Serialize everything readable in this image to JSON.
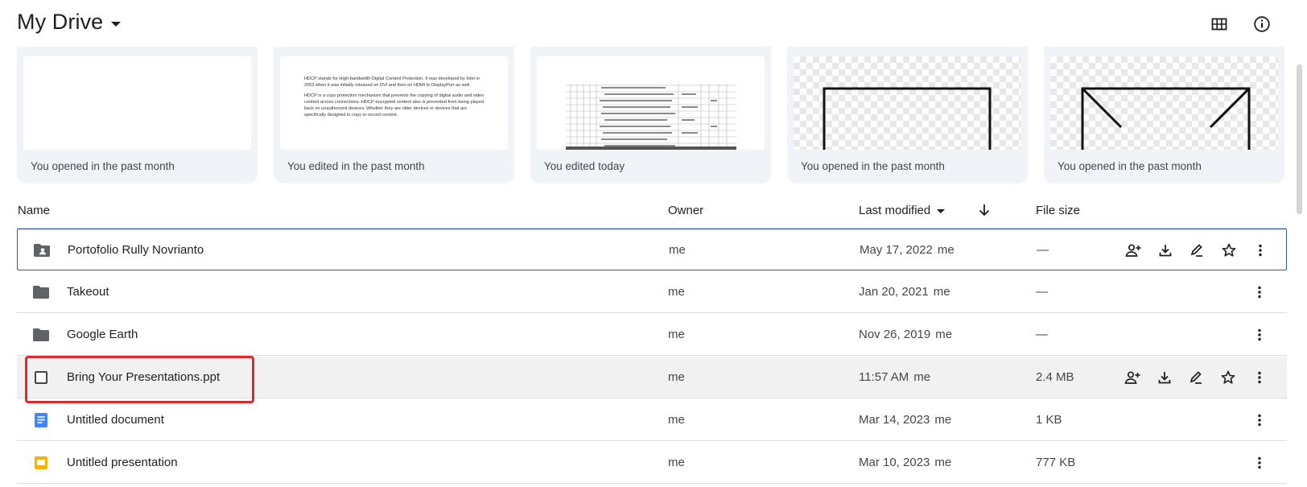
{
  "header": {
    "title": "My Drive",
    "icons": [
      "grid-view-icon",
      "info-icon"
    ]
  },
  "suggested": [
    {
      "caption": "You opened in the past month",
      "preview": "blank"
    },
    {
      "caption": "You edited in the past month",
      "preview": "document",
      "preview_text": [
        "HDCP stands for High-bandwidth Digital Content Protection. It was developed by Intel in 2003 when it was initially released on DVI and then on HDMI to DisplayPort as well.",
        "HDCP is a copy protection mechanism that prevents the copying of digital audio and video content across connections. HDCP-encrypted content also is prevented from being played back on unauthorized devices. Whether they are older devices or devices that are specifically designed to copy or record content."
      ]
    },
    {
      "caption": "You edited today",
      "preview": "spreadsheet"
    },
    {
      "caption": "You opened in the past month",
      "preview": "outline-frame"
    },
    {
      "caption": "You opened in the past month",
      "preview": "frame-with-diagonals"
    }
  ],
  "table": {
    "headers": {
      "name": "Name",
      "owner": "Owner",
      "last_modified": "Last modified",
      "file_size": "File size"
    },
    "rows": [
      {
        "icon": "shared-folder-icon",
        "name": "Portofolio Rully Novrianto",
        "owner": "me",
        "modified": "May 17, 2022",
        "modified_by": "me",
        "size": "—",
        "state": "selected",
        "actions": [
          "share-icon",
          "download-icon",
          "rename-icon",
          "star-icon",
          "more-icon"
        ]
      },
      {
        "icon": "folder-icon",
        "name": "Takeout",
        "owner": "me",
        "modified": "Jan 20, 2021",
        "modified_by": "me",
        "size": "—",
        "state": "normal",
        "actions": [
          "more-icon"
        ]
      },
      {
        "icon": "folder-icon",
        "name": "Google Earth",
        "owner": "me",
        "modified": "Nov 26, 2019",
        "modified_by": "me",
        "size": "—",
        "state": "normal",
        "actions": [
          "more-icon"
        ]
      },
      {
        "icon": "checkbox-icon",
        "name": "Bring Your Presentations.ppt",
        "owner": "me",
        "modified": "11:57 AM",
        "modified_by": "me",
        "size": "2.4 MB",
        "state": "hovered",
        "actions": [
          "share-icon",
          "download-icon",
          "rename-icon",
          "star-icon",
          "more-icon"
        ]
      },
      {
        "icon": "docs-icon",
        "name": "Untitled document",
        "owner": "me",
        "modified": "Mar 14, 2023",
        "modified_by": "me",
        "size": "1 KB",
        "state": "normal",
        "actions": [
          "more-icon"
        ]
      },
      {
        "icon": "slides-icon",
        "name": "Untitled presentation",
        "owner": "me",
        "modified": "Mar 10, 2023",
        "modified_by": "me",
        "size": "777 KB",
        "state": "normal",
        "actions": [
          "more-icon"
        ]
      }
    ]
  },
  "colors": {
    "card_bg": "#f0f4f9",
    "selected_border": "#3a57a8",
    "highlight": "#e3262b",
    "docs_blue": "#4285f4",
    "slides_yellow": "#f4b400"
  }
}
